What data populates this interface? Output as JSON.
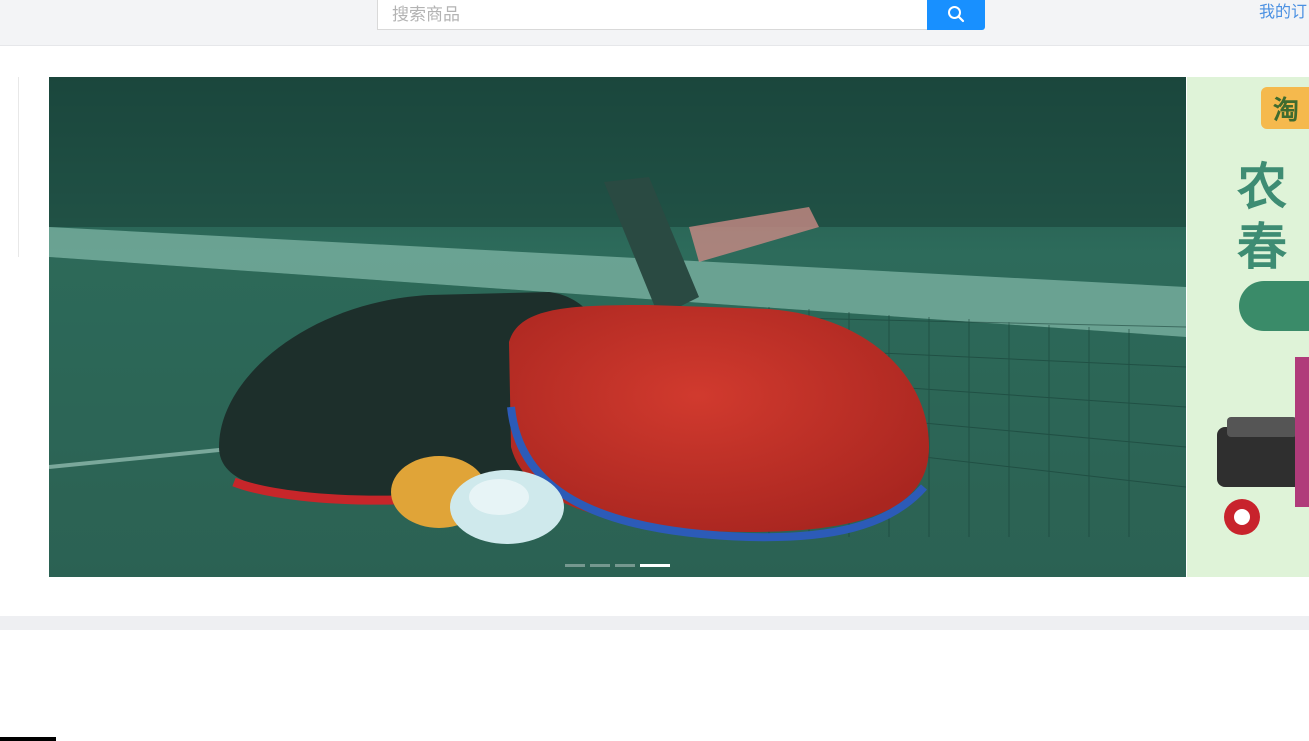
{
  "header": {
    "search_placeholder": "搜索商品",
    "my_orders_label": "我的订"
  },
  "carousel": {
    "slide_count": 4,
    "active_index": 3
  },
  "next_slide": {
    "badge_text": "淘",
    "line1": "农",
    "line2": "春"
  },
  "colors": {
    "primary": "#1890ff",
    "link": "#4a90e2",
    "topbar_bg": "#f3f4f6"
  }
}
